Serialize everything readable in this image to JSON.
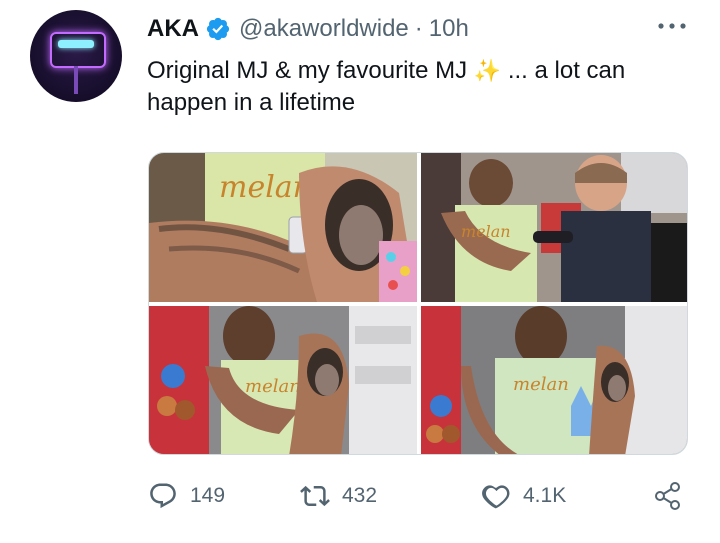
{
  "author": {
    "name": "AKA",
    "handle": "@akaworldwide",
    "separator": "·",
    "time": "10h",
    "verified": true,
    "avatar_icon": "neon-sign-avatar"
  },
  "tweet": {
    "text_before_emoji": "Original MJ & my favourite MJ ",
    "emoji": "✨",
    "text_after_emoji": " ... a lot can happen in a lifetime"
  },
  "media": {
    "count": 4,
    "photos": [
      "tattoo-closeup",
      "tattoo-artist-working",
      "arm-tattoo-side",
      "arm-tattoo-front"
    ]
  },
  "actions": {
    "replies": "149",
    "retweets": "432",
    "likes": "4.1K"
  },
  "colors": {
    "text": "#0f1419",
    "muted": "#536471",
    "verified_blue": "#1d9bf0",
    "border": "#cfd9de"
  },
  "icons": [
    "more-icon",
    "verified-badge-icon",
    "reply-icon",
    "retweet-icon",
    "like-icon",
    "share-icon"
  ]
}
